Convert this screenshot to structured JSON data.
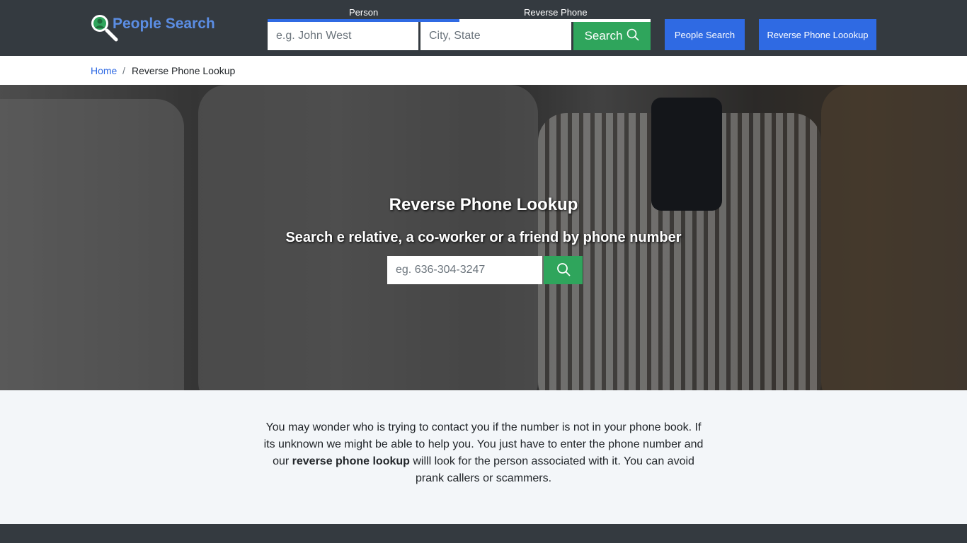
{
  "header": {
    "logo_text": "People Search",
    "tabs": [
      {
        "label": "Person",
        "active": true
      },
      {
        "label": "Reverse Phone",
        "active": false
      }
    ],
    "name_input": {
      "value": "",
      "placeholder": "e.g. John West"
    },
    "location_input": {
      "value": "",
      "placeholder": "City, State"
    },
    "search_button": "Search",
    "nav_buttons": [
      "People Search",
      "Reverse Phone Loookup"
    ],
    "colors": {
      "accent_blue": "#2f6ae3",
      "search_green": "#2fa55c",
      "bar": "#343a40"
    }
  },
  "breadcrumb": {
    "home": "Home",
    "separator": "/",
    "current": "Reverse Phone Lookup"
  },
  "hero": {
    "title": "Reverse Phone Lookup",
    "subtitle": "Search e relative, a co-worker or a friend by phone number",
    "phone_input": {
      "value": "",
      "placeholder": "eg. 636-304-3247"
    }
  },
  "intro": {
    "part1": "You may wonder who is trying to contact you if the number is not in your phone book. If its unknown we might be able to help you. You just have to enter the phone number and our ",
    "bold": "reverse phone lookup",
    "part2": " willl look for the person associated with it. You can avoid prank callers or scammers."
  }
}
